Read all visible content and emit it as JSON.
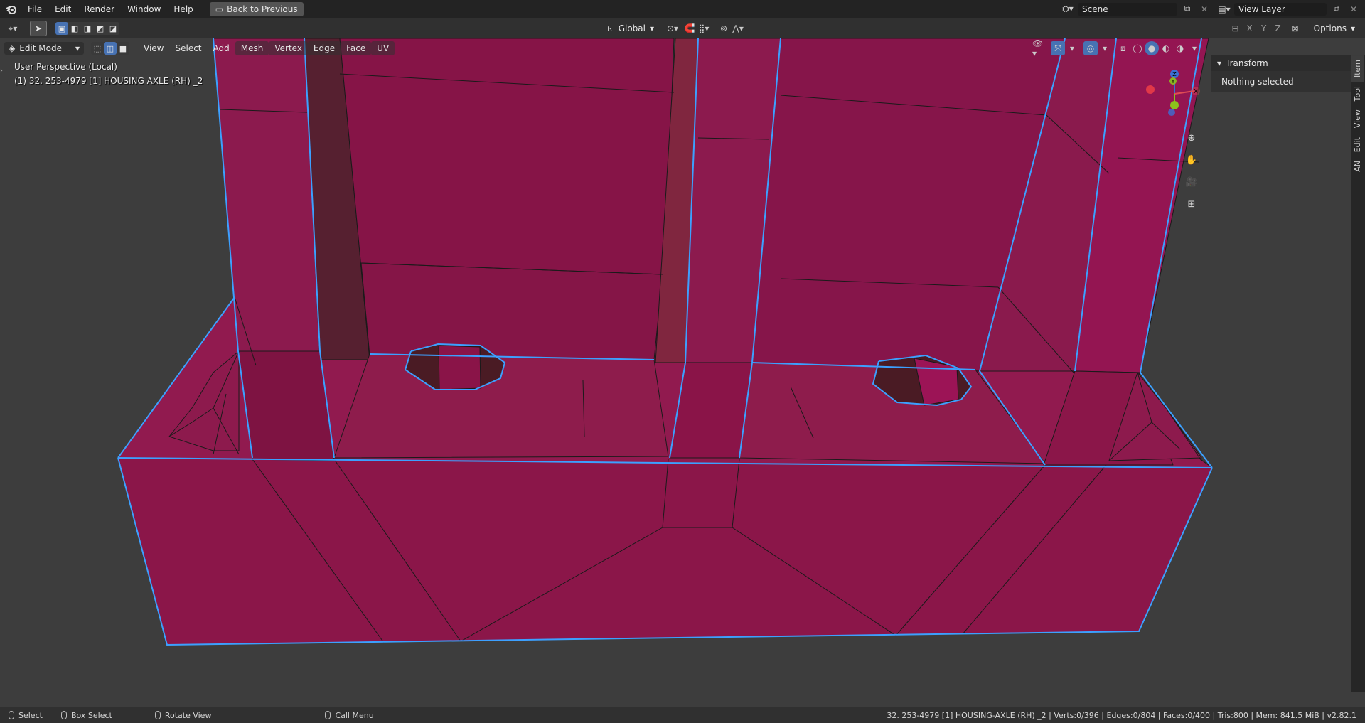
{
  "topbar": {
    "menus": [
      "File",
      "Edit",
      "Render",
      "Window",
      "Help"
    ],
    "back_button": "Back to Previous",
    "scene_name": "Scene",
    "view_layer_name": "View Layer"
  },
  "toolbar": {
    "transform_orientation": "Global",
    "axes": [
      "X",
      "Y",
      "Z"
    ],
    "options_label": "Options"
  },
  "editbar": {
    "mode": "Edit Mode",
    "menus": [
      "View",
      "Select",
      "Add",
      "Mesh",
      "Vertex",
      "Edge",
      "Face",
      "UV"
    ]
  },
  "viewport": {
    "perspective_label": "User Perspective (Local)",
    "object_info": "(1) 32. 253-4979 [1] HOUSING AXLE (RH) _2",
    "gizmo": {
      "x": "X",
      "y": "Y",
      "z": "Z"
    },
    "colors": {
      "mesh_face": "#8a1a4d",
      "mesh_edge": "#1a1a1a",
      "selection_outline": "#3ca0ff",
      "background": "#3d3d3d"
    }
  },
  "npanel": {
    "tabs": [
      "Item",
      "Tool",
      "View",
      "Edit",
      "AN"
    ],
    "active_tab": "Item",
    "panel_title": "Transform",
    "panel_body": "Nothing selected"
  },
  "statusbar": {
    "left": [
      {
        "icon": "mouse-left-icon",
        "label": "Select"
      },
      {
        "icon": "box-select-icon",
        "label": "Box Select"
      },
      {
        "icon": "mouse-middle-icon",
        "label": "Rotate View"
      },
      {
        "icon": "mouse-right-icon",
        "label": "Call Menu"
      }
    ],
    "stats": "32. 253-4979 [1] HOUSING-AXLE (RH) _2 | Verts:0/396 | Edges:0/804 | Faces:0/400 | Tris:800 | Mem: 841.5 MiB | v2.82.1"
  }
}
